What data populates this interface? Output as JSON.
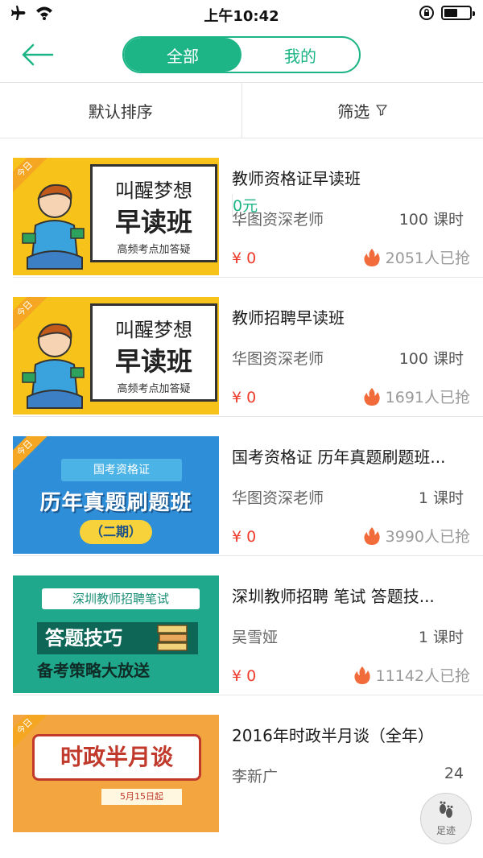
{
  "status_bar": {
    "time": "上午10:42",
    "icons": [
      "airplane-icon",
      "wifi-icon",
      "rotation-lock-icon",
      "battery-icon"
    ]
  },
  "header": {
    "back_icon": "arrow-left-icon",
    "tabs": [
      {
        "label": "全部",
        "active": true
      },
      {
        "label": "我的",
        "active": false
      }
    ]
  },
  "filter_bar": {
    "sort_label": "默认排序",
    "price_label": "0元",
    "filter_label": "筛选"
  },
  "colors": {
    "accent": "#1db585",
    "price_red": "#ef3b2c",
    "muted": "#9a9a9a"
  },
  "courses": [
    {
      "title": "教师资格证早读班",
      "teacher": "华图资深老师",
      "hours": "100 课时",
      "price": "¥ 0",
      "grabbed": "2051人已抢",
      "thumb": {
        "badge": "今日",
        "line1": "叫醒梦想",
        "line2": "早读班",
        "line3": "高频考点加答疑"
      }
    },
    {
      "title": "教师招聘早读班",
      "teacher": "华图资深老师",
      "hours": "100 课时",
      "price": "¥ 0",
      "grabbed": "1691人已抢",
      "thumb": {
        "badge": "今日",
        "line1": "叫醒梦想",
        "line2": "早读班",
        "line3": "高频考点加答疑"
      }
    },
    {
      "title": "国考资格证 历年真题刷题班...",
      "teacher": "华图资深老师",
      "hours": "1 课时",
      "price": "¥ 0",
      "grabbed": "3990人已抢",
      "thumb": {
        "badge": "今日",
        "banner": "国考资格证",
        "main": "历年真题刷题班",
        "sub": "（二期）"
      }
    },
    {
      "title": "深圳教师招聘 笔试  答题技...",
      "teacher": "吴雪娅",
      "hours": "1 课时",
      "price": "¥ 0",
      "grabbed": "11142人已抢",
      "thumb": {
        "tag": "深圳教师招聘笔试",
        "main": "答题技巧",
        "sub": "备考策略大放送"
      }
    },
    {
      "title": "2016年时政半月谈（全年）",
      "teacher": "李新广",
      "hours": "24",
      "thumb": {
        "badge": "今日",
        "main": "时政半月谈",
        "date": "5月15日起"
      }
    }
  ],
  "fab": {
    "label": "足迹",
    "icon": "footprint-icon"
  }
}
